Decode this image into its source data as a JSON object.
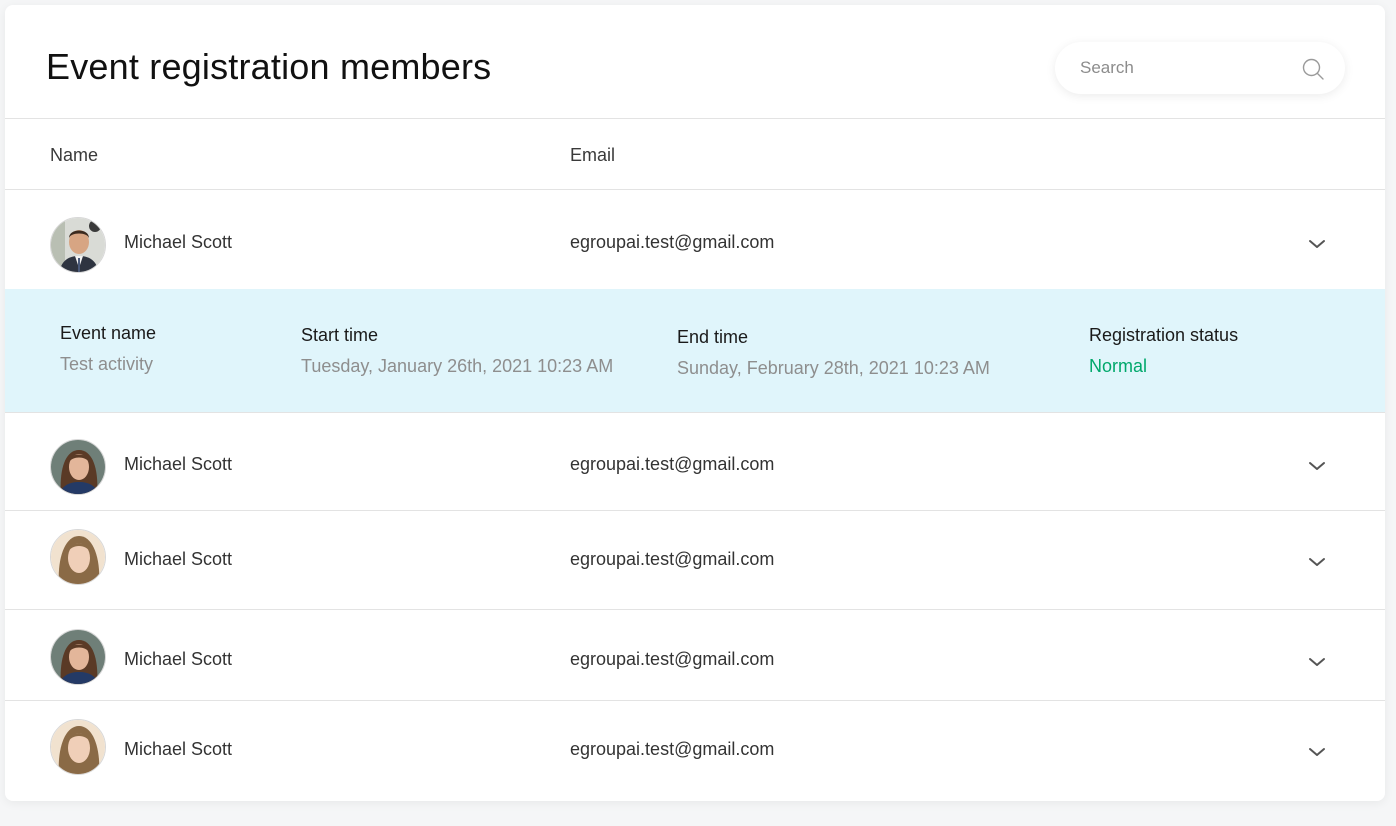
{
  "page": {
    "title": "Event registration members"
  },
  "search": {
    "placeholder": "Search"
  },
  "table": {
    "columns": {
      "name": "Name",
      "email": "Email"
    },
    "rows": [
      {
        "name": "Michael Scott",
        "email": "egroupai.test@gmail.com",
        "expanded": true
      },
      {
        "name": "Michael Scott",
        "email": "egroupai.test@gmail.com",
        "expanded": false
      },
      {
        "name": "Michael Scott",
        "email": "egroupai.test@gmail.com",
        "expanded": false
      },
      {
        "name": "Michael Scott",
        "email": "egroupai.test@gmail.com",
        "expanded": false
      },
      {
        "name": "Michael Scott",
        "email": "egroupai.test@gmail.com",
        "expanded": false
      }
    ]
  },
  "details": {
    "event_name_label": "Event name",
    "event_name": "Test activity",
    "start_time_label": "Start time",
    "start_time": "Tuesday, January 26th, 2021 10:23 AM",
    "end_time_label": "End time",
    "end_time": "Sunday, February 28th, 2021 10:23 AM",
    "status_label": "Registration status",
    "status": "Normal"
  },
  "colors": {
    "status_normal": "#00a86b",
    "details_background": "#e0f5fb"
  },
  "icons": {
    "search": "search-icon",
    "expand": "chevron-down-icon"
  }
}
